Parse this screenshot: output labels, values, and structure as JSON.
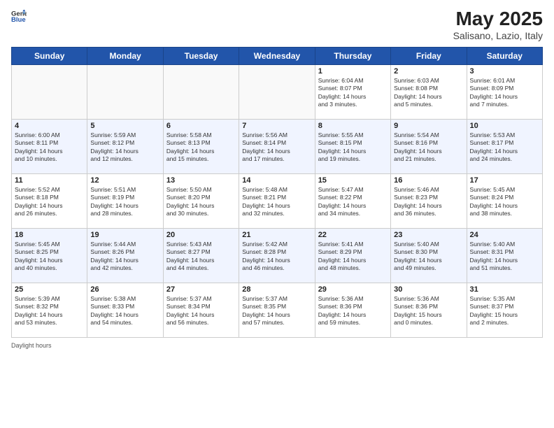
{
  "header": {
    "logo_general": "General",
    "logo_blue": "Blue",
    "title": "May 2025",
    "subtitle": "Salisano, Lazio, Italy"
  },
  "days_of_week": [
    "Sunday",
    "Monday",
    "Tuesday",
    "Wednesday",
    "Thursday",
    "Friday",
    "Saturday"
  ],
  "weeks": [
    [
      {
        "day": "",
        "text": ""
      },
      {
        "day": "",
        "text": ""
      },
      {
        "day": "",
        "text": ""
      },
      {
        "day": "",
        "text": ""
      },
      {
        "day": "1",
        "text": "Sunrise: 6:04 AM\nSunset: 8:07 PM\nDaylight: 14 hours\nand 3 minutes."
      },
      {
        "day": "2",
        "text": "Sunrise: 6:03 AM\nSunset: 8:08 PM\nDaylight: 14 hours\nand 5 minutes."
      },
      {
        "day": "3",
        "text": "Sunrise: 6:01 AM\nSunset: 8:09 PM\nDaylight: 14 hours\nand 7 minutes."
      }
    ],
    [
      {
        "day": "4",
        "text": "Sunrise: 6:00 AM\nSunset: 8:11 PM\nDaylight: 14 hours\nand 10 minutes."
      },
      {
        "day": "5",
        "text": "Sunrise: 5:59 AM\nSunset: 8:12 PM\nDaylight: 14 hours\nand 12 minutes."
      },
      {
        "day": "6",
        "text": "Sunrise: 5:58 AM\nSunset: 8:13 PM\nDaylight: 14 hours\nand 15 minutes."
      },
      {
        "day": "7",
        "text": "Sunrise: 5:56 AM\nSunset: 8:14 PM\nDaylight: 14 hours\nand 17 minutes."
      },
      {
        "day": "8",
        "text": "Sunrise: 5:55 AM\nSunset: 8:15 PM\nDaylight: 14 hours\nand 19 minutes."
      },
      {
        "day": "9",
        "text": "Sunrise: 5:54 AM\nSunset: 8:16 PM\nDaylight: 14 hours\nand 21 minutes."
      },
      {
        "day": "10",
        "text": "Sunrise: 5:53 AM\nSunset: 8:17 PM\nDaylight: 14 hours\nand 24 minutes."
      }
    ],
    [
      {
        "day": "11",
        "text": "Sunrise: 5:52 AM\nSunset: 8:18 PM\nDaylight: 14 hours\nand 26 minutes."
      },
      {
        "day": "12",
        "text": "Sunrise: 5:51 AM\nSunset: 8:19 PM\nDaylight: 14 hours\nand 28 minutes."
      },
      {
        "day": "13",
        "text": "Sunrise: 5:50 AM\nSunset: 8:20 PM\nDaylight: 14 hours\nand 30 minutes."
      },
      {
        "day": "14",
        "text": "Sunrise: 5:48 AM\nSunset: 8:21 PM\nDaylight: 14 hours\nand 32 minutes."
      },
      {
        "day": "15",
        "text": "Sunrise: 5:47 AM\nSunset: 8:22 PM\nDaylight: 14 hours\nand 34 minutes."
      },
      {
        "day": "16",
        "text": "Sunrise: 5:46 AM\nSunset: 8:23 PM\nDaylight: 14 hours\nand 36 minutes."
      },
      {
        "day": "17",
        "text": "Sunrise: 5:45 AM\nSunset: 8:24 PM\nDaylight: 14 hours\nand 38 minutes."
      }
    ],
    [
      {
        "day": "18",
        "text": "Sunrise: 5:45 AM\nSunset: 8:25 PM\nDaylight: 14 hours\nand 40 minutes."
      },
      {
        "day": "19",
        "text": "Sunrise: 5:44 AM\nSunset: 8:26 PM\nDaylight: 14 hours\nand 42 minutes."
      },
      {
        "day": "20",
        "text": "Sunrise: 5:43 AM\nSunset: 8:27 PM\nDaylight: 14 hours\nand 44 minutes."
      },
      {
        "day": "21",
        "text": "Sunrise: 5:42 AM\nSunset: 8:28 PM\nDaylight: 14 hours\nand 46 minutes."
      },
      {
        "day": "22",
        "text": "Sunrise: 5:41 AM\nSunset: 8:29 PM\nDaylight: 14 hours\nand 48 minutes."
      },
      {
        "day": "23",
        "text": "Sunrise: 5:40 AM\nSunset: 8:30 PM\nDaylight: 14 hours\nand 49 minutes."
      },
      {
        "day": "24",
        "text": "Sunrise: 5:40 AM\nSunset: 8:31 PM\nDaylight: 14 hours\nand 51 minutes."
      }
    ],
    [
      {
        "day": "25",
        "text": "Sunrise: 5:39 AM\nSunset: 8:32 PM\nDaylight: 14 hours\nand 53 minutes."
      },
      {
        "day": "26",
        "text": "Sunrise: 5:38 AM\nSunset: 8:33 PM\nDaylight: 14 hours\nand 54 minutes."
      },
      {
        "day": "27",
        "text": "Sunrise: 5:37 AM\nSunset: 8:34 PM\nDaylight: 14 hours\nand 56 minutes."
      },
      {
        "day": "28",
        "text": "Sunrise: 5:37 AM\nSunset: 8:35 PM\nDaylight: 14 hours\nand 57 minutes."
      },
      {
        "day": "29",
        "text": "Sunrise: 5:36 AM\nSunset: 8:36 PM\nDaylight: 14 hours\nand 59 minutes."
      },
      {
        "day": "30",
        "text": "Sunrise: 5:36 AM\nSunset: 8:36 PM\nDaylight: 15 hours\nand 0 minutes."
      },
      {
        "day": "31",
        "text": "Sunrise: 5:35 AM\nSunset: 8:37 PM\nDaylight: 15 hours\nand 2 minutes."
      }
    ]
  ],
  "footer": {
    "daylight_label": "Daylight hours"
  }
}
